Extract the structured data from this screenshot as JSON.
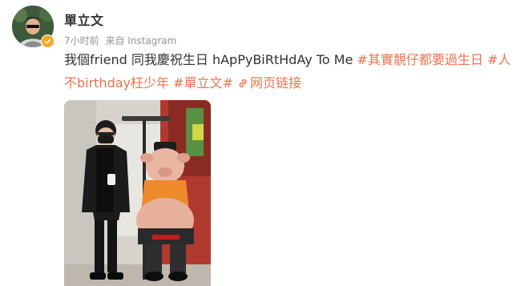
{
  "post": {
    "username": "單立文",
    "time": "7小时前",
    "source": "来自 Instagram",
    "text_plain_1": "我個friend 同我慶祝生日 hApPyBiRtHdAy To Me ",
    "hashtag_1": "#其實靚仔都要過生日",
    "text_plain_2": " ",
    "hashtag_2": "#人不birthday枉少年",
    "text_plain_3": " ",
    "hashtag_3": "#單立文#",
    "text_plain_4": " ",
    "link_label": "网页链接"
  },
  "icons": {
    "verified": "verified-badge-icon",
    "link": "link-icon"
  },
  "colors": {
    "accent": "#eb7350",
    "meta": "#939393",
    "verified": "#f5a623",
    "text": "#333333"
  }
}
